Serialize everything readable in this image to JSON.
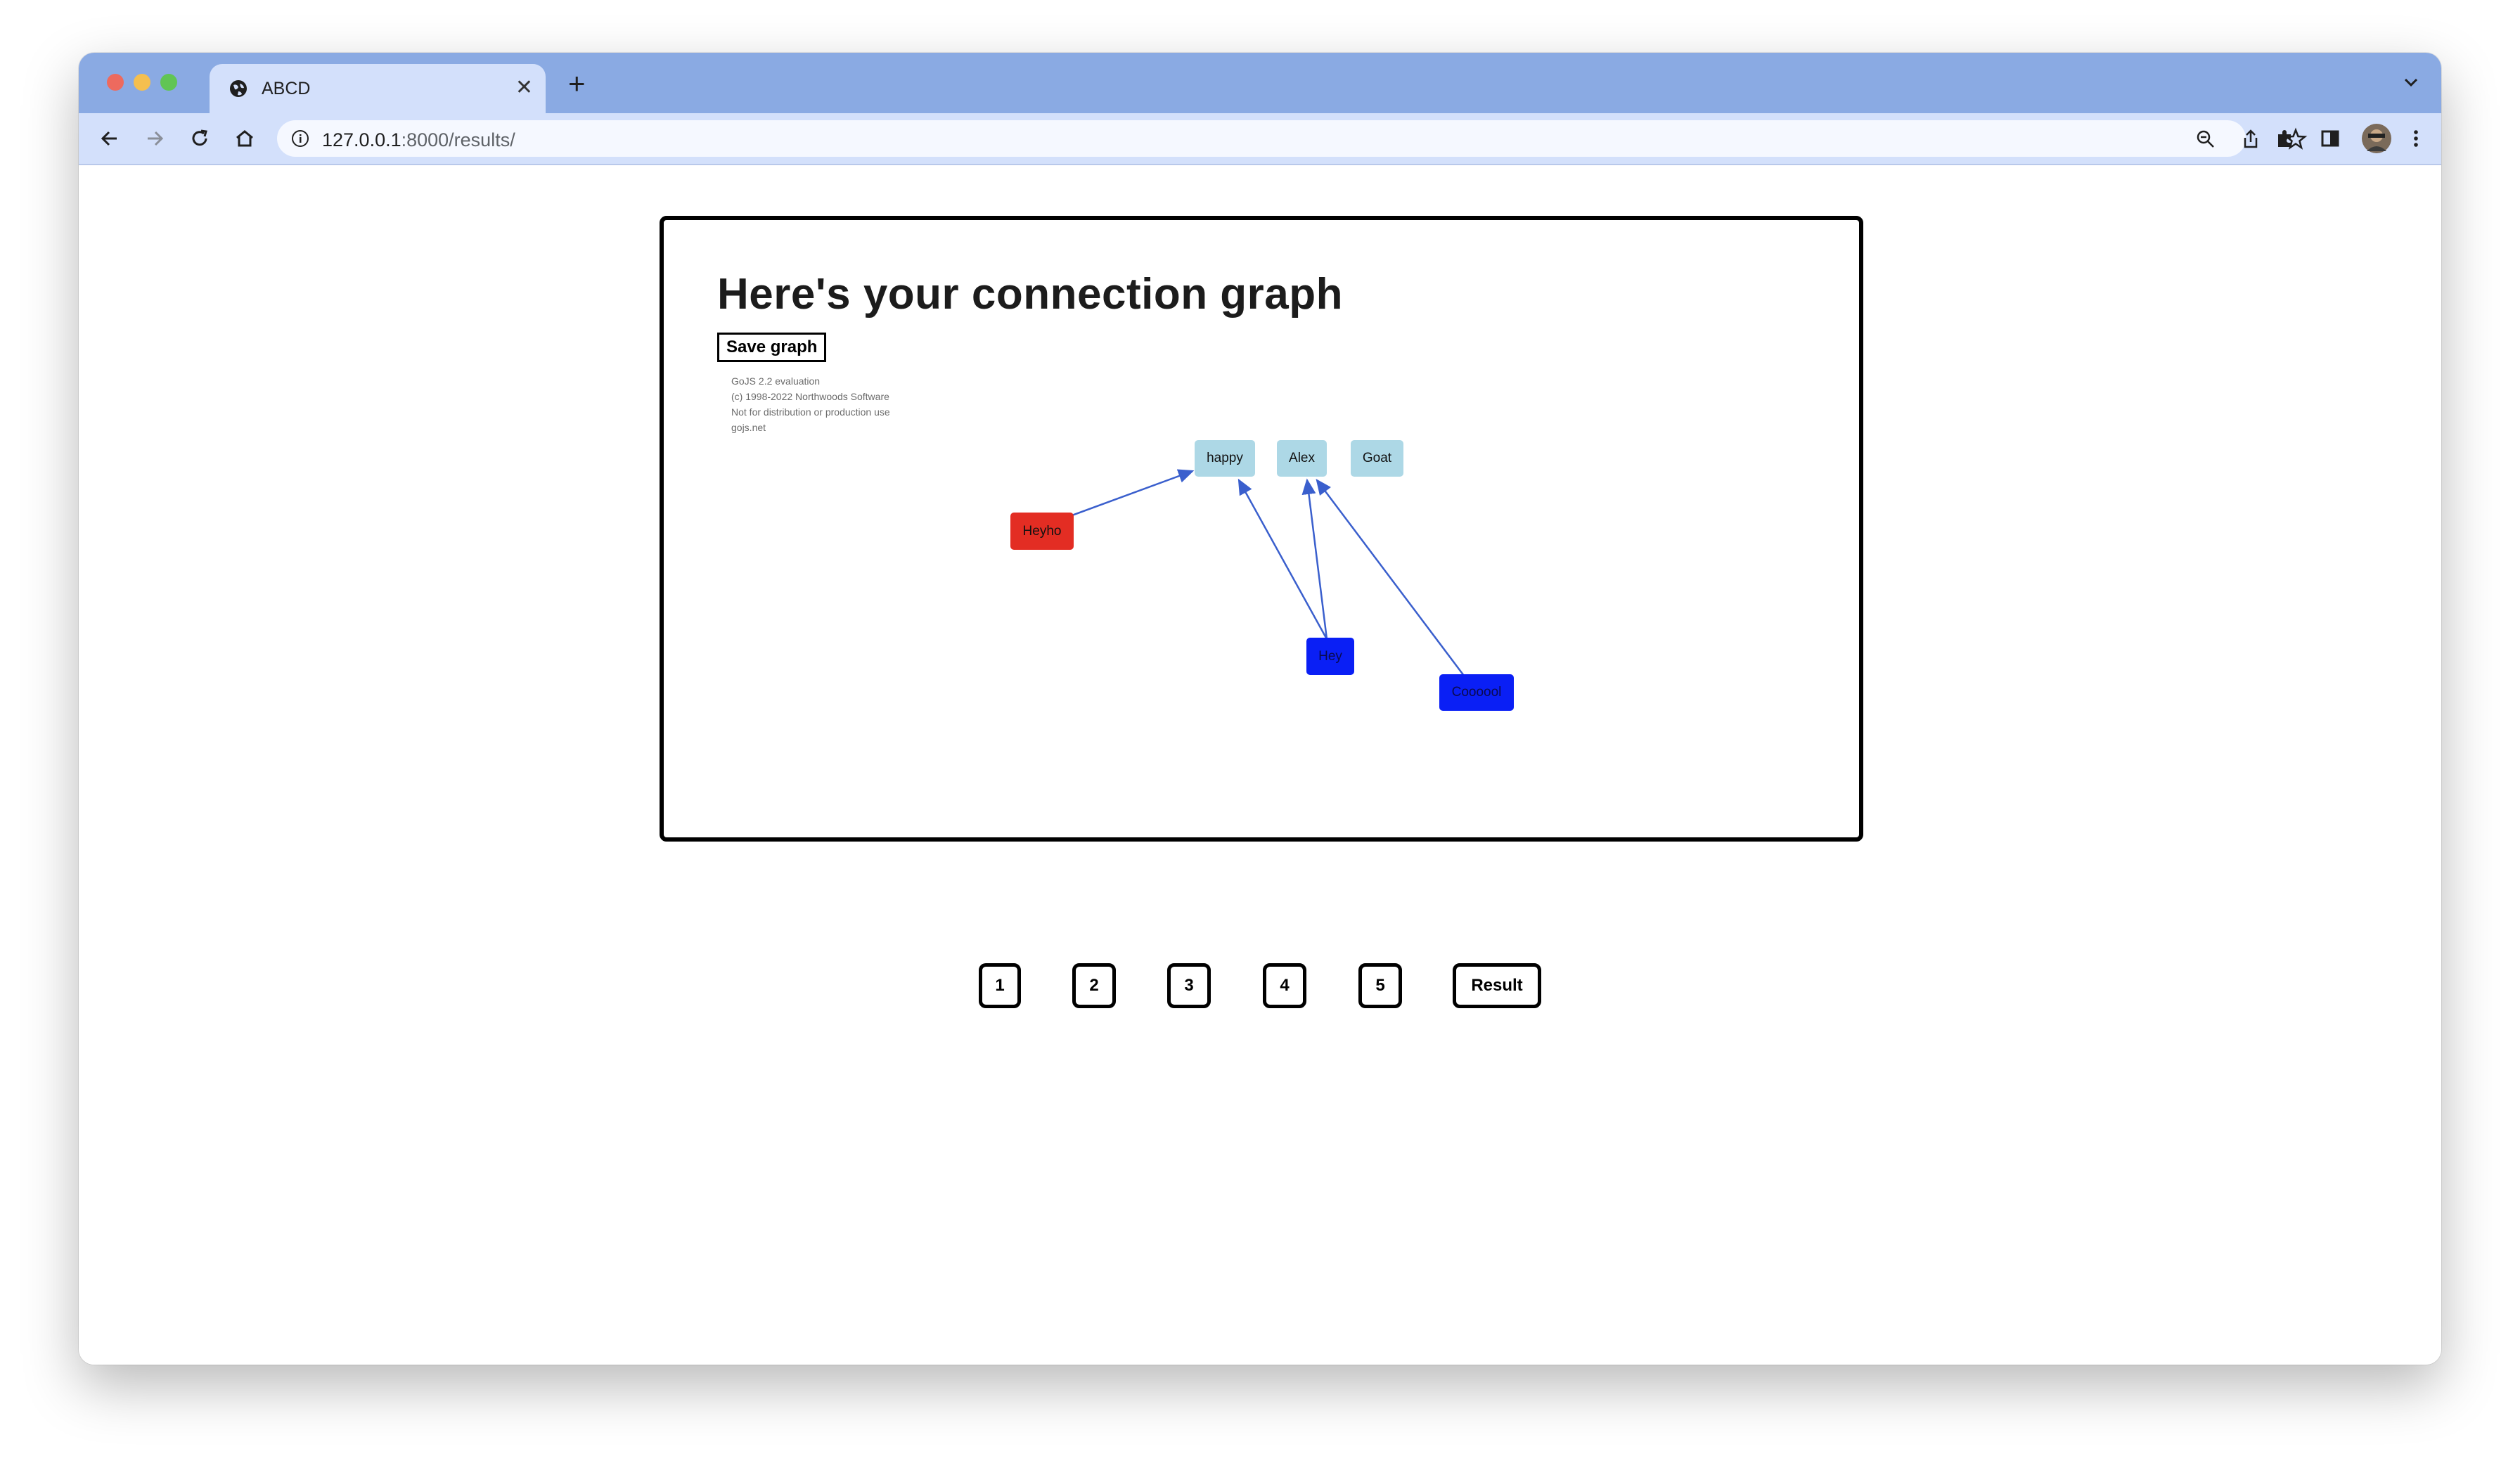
{
  "browser": {
    "tab_title": "ABCD",
    "url_host": "127.0.0.1",
    "url_rest": ":8000/results/"
  },
  "page": {
    "heading": "Here's your connection graph",
    "save_button": "Save graph",
    "watermark": [
      "GoJS 2.2 evaluation",
      "(c) 1998-2022 Northwoods Software",
      "Not for distribution or production use",
      "gojs.net"
    ]
  },
  "graph": {
    "nodes": [
      {
        "label": "happy",
        "color": "#add8e6"
      },
      {
        "label": "Alex",
        "color": "#add8e6"
      },
      {
        "label": "Goat",
        "color": "#add8e6"
      },
      {
        "label": "Heyho",
        "color": "#e32d23"
      },
      {
        "label": "Hey",
        "color": "#0a1ff5"
      },
      {
        "label": "Coooool",
        "color": "#0a1ff5"
      }
    ],
    "links": [
      {
        "from": "Heyho",
        "to": "happy"
      },
      {
        "from": "Hey",
        "to": "happy"
      },
      {
        "from": "Hey",
        "to": "Alex"
      },
      {
        "from": "Coooool",
        "to": "Alex"
      }
    ],
    "link_color": "#3a5fcd"
  },
  "pager": {
    "buttons": [
      "1",
      "2",
      "3",
      "4",
      "5",
      "Result"
    ]
  }
}
